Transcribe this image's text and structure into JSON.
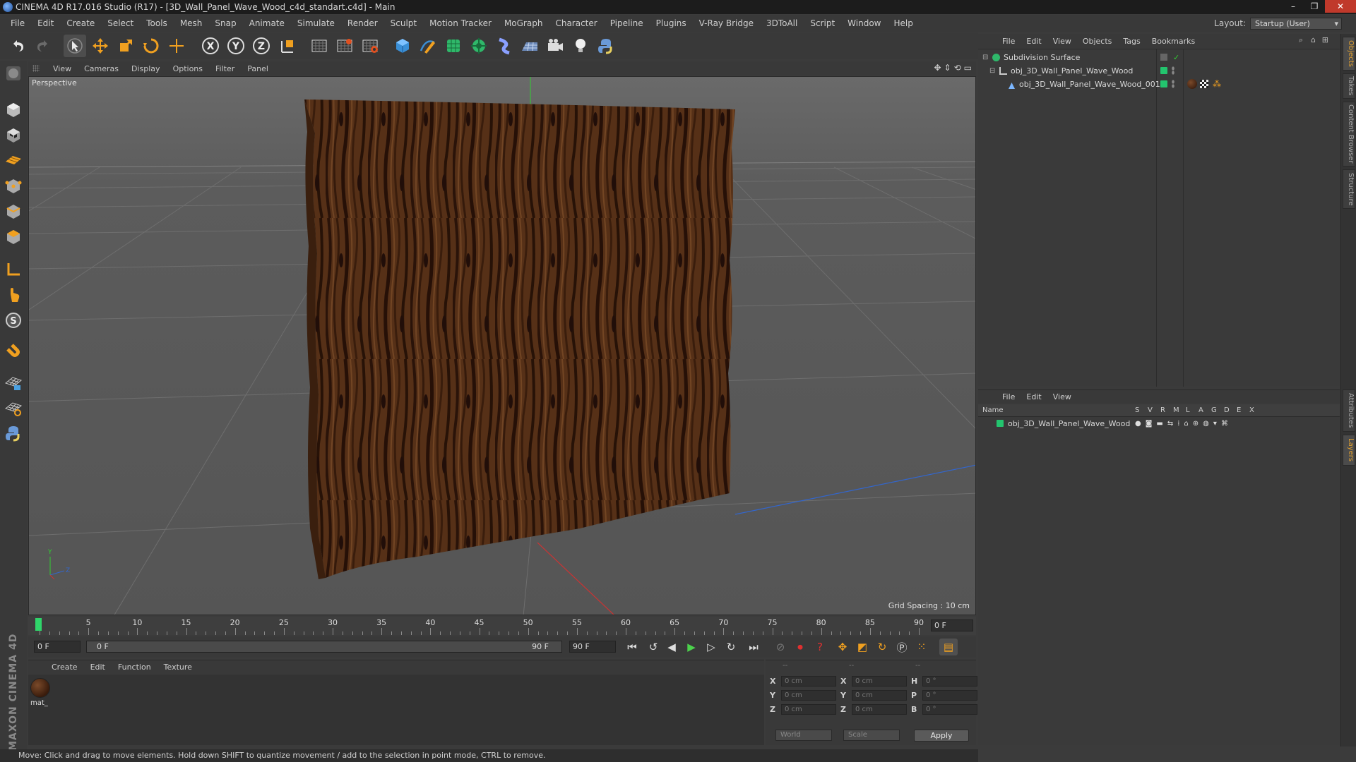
{
  "window": {
    "title": "CINEMA 4D R17.016 Studio (R17) - [3D_Wall_Panel_Wave_Wood_c4d_standart.c4d] - Main",
    "buttons": [
      "–",
      "❐",
      "✕"
    ]
  },
  "menubar": {
    "items": [
      "File",
      "Edit",
      "Create",
      "Select",
      "Tools",
      "Mesh",
      "Snap",
      "Animate",
      "Simulate",
      "Render",
      "Sculpt",
      "Motion Tracker",
      "MoGraph",
      "Character",
      "Pipeline",
      "Plugins",
      "V-Ray Bridge",
      "3DToAll",
      "Script",
      "Window",
      "Help"
    ],
    "layout_label": "Layout:",
    "layout_value": "Startup (User)"
  },
  "toolbar": {
    "icons": [
      "undo-icon",
      "redo-icon",
      "select-arrow-icon",
      "move-icon",
      "scale-icon",
      "rotate-icon",
      "move-axis-icon",
      "x-axis-icon",
      "y-axis-icon",
      "z-axis-icon",
      "coordinate-system-icon",
      "render-view-icon",
      "render-picture-viewer-icon",
      "edit-render-settings-icon",
      "cube-icon",
      "pen-spline-icon",
      "subdivision-icon",
      "cloner-icon",
      "deformer-icon",
      "floor-icon",
      "camera-icon",
      "light-icon",
      "python-icon"
    ],
    "axis_labels": [
      "X",
      "Y",
      "Z"
    ]
  },
  "viewport": {
    "menu": [
      "View",
      "Cameras",
      "Display",
      "Options",
      "Filter",
      "Panel"
    ],
    "label": "Perspective",
    "grid_spacing": "Grid Spacing : 10 cm"
  },
  "timeline": {
    "ticks": [
      "0",
      "5",
      "10",
      "15",
      "20",
      "25",
      "30",
      "35",
      "40",
      "45",
      "50",
      "55",
      "60",
      "65",
      "70",
      "75",
      "80",
      "85",
      "90"
    ],
    "current_frame": "0 F",
    "start_field": "0 F",
    "range_start": "0 F",
    "range_end": "90 F",
    "end_field": "90 F"
  },
  "materials": {
    "menu": [
      "Create",
      "Edit",
      "Function",
      "Texture"
    ],
    "items": [
      {
        "name": "mat_"
      }
    ]
  },
  "coordinates": {
    "headers": [
      "--",
      "--",
      "--"
    ],
    "rows": [
      {
        "a": "X",
        "av": "0 cm",
        "b": "X",
        "bv": "0 cm",
        "c": "H",
        "cv": "0 °"
      },
      {
        "a": "Y",
        "av": "0 cm",
        "b": "Y",
        "bv": "0 cm",
        "c": "P",
        "cv": "0 °"
      },
      {
        "a": "Z",
        "av": "0 cm",
        "b": "Z",
        "bv": "0 cm",
        "c": "B",
        "cv": "0 °"
      }
    ],
    "space": "World",
    "mode": "Scale",
    "apply": "Apply"
  },
  "status": "Move: Click and drag to move elements. Hold down SHIFT to quantize movement / add to the selection in point mode, CTRL to remove.",
  "object_manager": {
    "menu": [
      "File",
      "Edit",
      "View",
      "Objects",
      "Tags",
      "Bookmarks"
    ],
    "objects": [
      {
        "name": "Subdivision Surface"
      },
      {
        "name": "obj_3D_Wall_Panel_Wave_Wood"
      },
      {
        "name": "obj_3D_Wall_Panel_Wave_Wood_001"
      }
    ]
  },
  "layer_manager": {
    "menu": [
      "File",
      "Edit",
      "View"
    ],
    "header_name": "Name",
    "columns": [
      "S",
      "V",
      "R",
      "M",
      "L",
      "A",
      "G",
      "D",
      "E",
      "X"
    ],
    "layers": [
      {
        "name": "obj_3D_Wall_Panel_Wave_Wood"
      }
    ]
  },
  "side_tabs": [
    "Objects",
    "Takes",
    "Content Browser",
    "Structure",
    "Attributes",
    "Layers"
  ],
  "colors": {
    "accent_green": "#23c46e",
    "wood": "#5a3318",
    "x_axis": "#c33",
    "y_axis": "#3c3",
    "z_axis": "#36c"
  }
}
